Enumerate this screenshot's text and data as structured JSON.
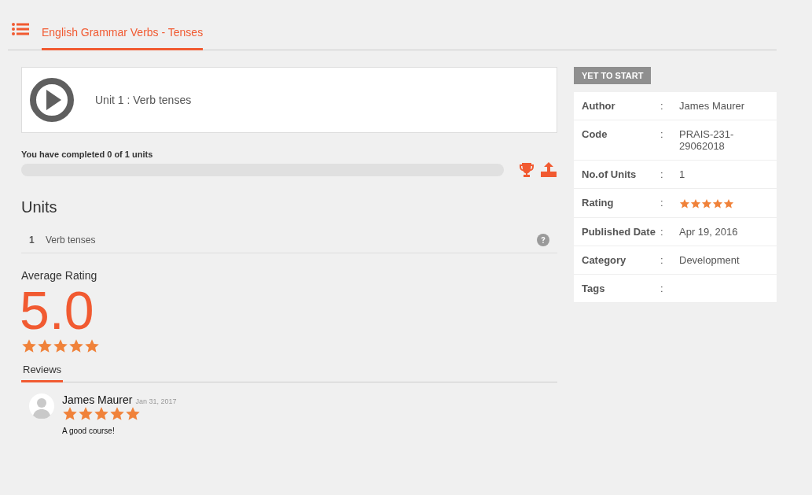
{
  "header": {
    "tabs": [
      {
        "label": "English Grammar Verbs - Tenses",
        "selected": true
      }
    ]
  },
  "current_unit": {
    "title": "Unit 1 : Verb tenses"
  },
  "progress": {
    "text": "You have completed 0 of 1 units",
    "level": 0
  },
  "units": {
    "heading": "Units",
    "items": [
      {
        "number": "1",
        "title": "Verb tenses"
      }
    ]
  },
  "average_rating": {
    "heading": "Average Rating",
    "value": "5.0",
    "stars": 5
  },
  "reviews": {
    "tabs": [
      {
        "label": "Reviews",
        "selected": true
      }
    ],
    "items": [
      {
        "name": "James Maurer",
        "date": "Jan 31, 2017",
        "stars": 5,
        "text": "A good course!"
      }
    ]
  },
  "status_badge": "YET TO START",
  "details": [
    {
      "kind": "text",
      "label": "Author",
      "separator": ":",
      "value": "James Maurer"
    },
    {
      "kind": "text",
      "label": "Code",
      "separator": ":",
      "value": "PRAIS-231-29062018"
    },
    {
      "kind": "text",
      "label": "No.of Units",
      "separator": ":",
      "value": "1"
    },
    {
      "kind": "stars",
      "label": "Rating",
      "separator": ":",
      "stars": 5
    },
    {
      "kind": "text",
      "label": "Published Date",
      "separator": ":",
      "value": "Apr 19, 2016"
    },
    {
      "kind": "text",
      "label": "Category",
      "separator": ":",
      "value": "Development"
    },
    {
      "kind": "text",
      "label": "Tags",
      "separator": ":"
    }
  ]
}
